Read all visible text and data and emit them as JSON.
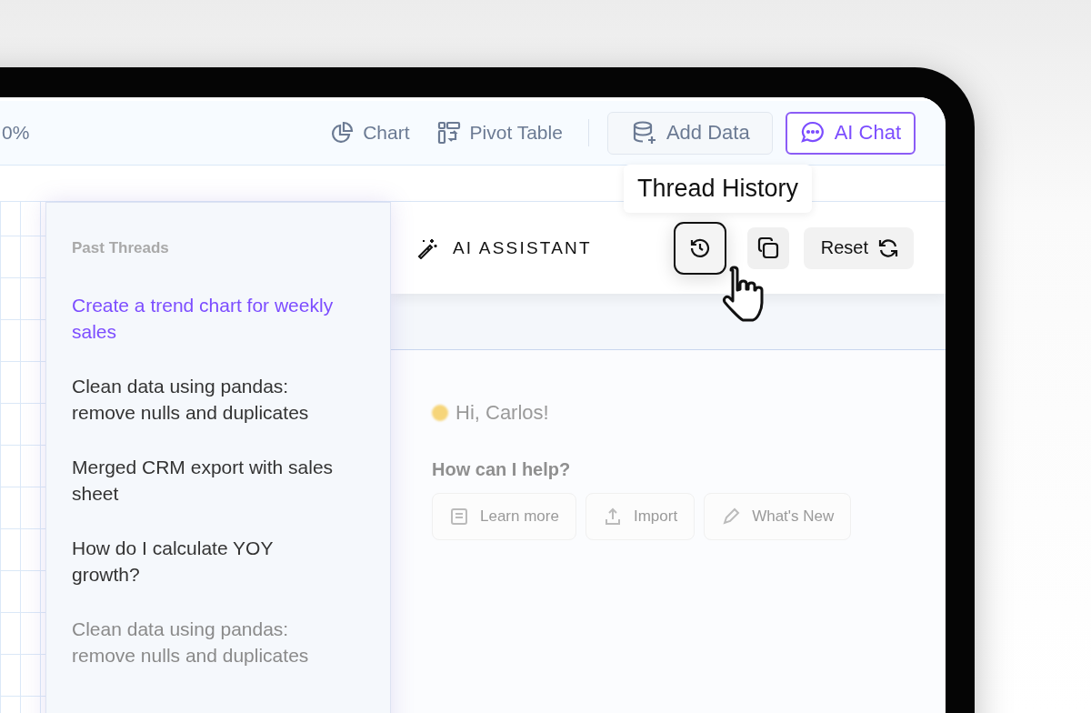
{
  "toolbar": {
    "zoom": "0%",
    "items": [
      {
        "label": "Chart",
        "kind": "chart"
      },
      {
        "label": "Pivot Table",
        "kind": "pivot"
      }
    ],
    "buttons": [
      {
        "label": "Add Data",
        "kind": "data",
        "selected": false
      },
      {
        "label": "AI Chat",
        "kind": "chat",
        "selected": true
      }
    ]
  },
  "thread_panel": {
    "title": "Past Threads",
    "threads": [
      {
        "label": "Create a trend chart for weekly sales",
        "selected": true,
        "faded": false
      },
      {
        "label": "Clean data using pandas: remove nulls and duplicates",
        "selected": false,
        "faded": false
      },
      {
        "label": "Merged CRM export with sales sheet",
        "selected": false,
        "faded": false
      },
      {
        "label": "How do I calculate YOY growth?",
        "selected": false,
        "faded": false
      },
      {
        "label": "Clean data using pandas: remove nulls and duplicates",
        "selected": false,
        "faded": true
      }
    ]
  },
  "assistant": {
    "title": "AI ASSISTANT",
    "tooltip": "Thread History",
    "reset": "Reset",
    "greeting": "Hi, Carlos!",
    "prompt": "How can I help?",
    "suggestions": [
      {
        "label": "Learn more",
        "kind": "book"
      },
      {
        "label": "Import",
        "kind": "import"
      },
      {
        "label": "What's New",
        "kind": "new"
      }
    ]
  }
}
